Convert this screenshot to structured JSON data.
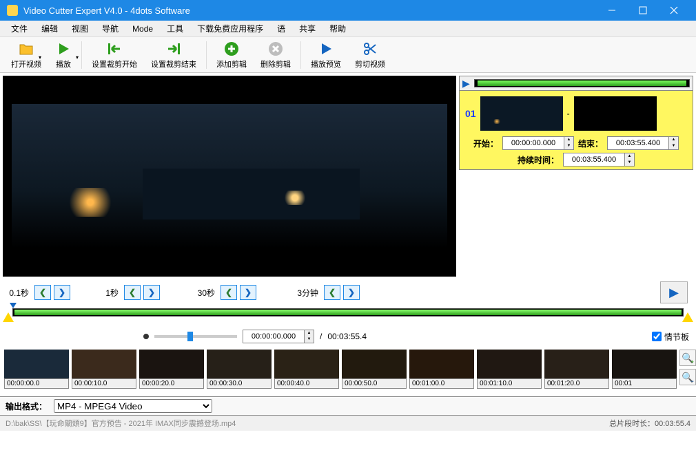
{
  "window": {
    "title": "Video Cutter Expert V4.0 - 4dots Software"
  },
  "menu": [
    "文件",
    "编辑",
    "视图",
    "导航",
    "Mode",
    "工具",
    "下载免费应用程序",
    "语",
    "共享",
    "帮助"
  ],
  "tools": [
    {
      "name": "open",
      "label": "打开视频",
      "icon": "folder",
      "color": "#fbc02d",
      "drop": true
    },
    {
      "name": "play",
      "label": "播放",
      "icon": "play",
      "color": "#2e9e1e",
      "drop": true
    },
    {
      "name": "set-start",
      "label": "设置裁剪开始",
      "icon": "arrow-left-bar",
      "color": "#2e9e1e"
    },
    {
      "name": "set-end",
      "label": "设置裁剪结束",
      "icon": "arrow-right-bar",
      "color": "#2e9e1e"
    },
    {
      "name": "add-cut",
      "label": "添加剪辑",
      "icon": "plus-circle",
      "color": "#2e9e1e"
    },
    {
      "name": "del-cut",
      "label": "删除剪辑",
      "icon": "x-circle",
      "color": "#bdbdbd"
    },
    {
      "name": "play-preview",
      "label": "播放预览",
      "icon": "play",
      "color": "#1565c0"
    },
    {
      "name": "cut-video",
      "label": "剪切视频",
      "icon": "scissors",
      "color": "#1565c0"
    }
  ],
  "clip": {
    "index": "01",
    "start_label": "开始：",
    "start": "00:00:00.000",
    "end_label": "结束：",
    "end": "00:03:55.400",
    "dur_label": "持续时间：",
    "dur": "00:03:55.400"
  },
  "seek": {
    "g1": "0.1秒",
    "g2": "1秒",
    "g3": "30秒",
    "g4": "3分钟"
  },
  "pos": {
    "current": "00:00:00.000",
    "total": "00:03:55.4",
    "storyboard_label": "情节板"
  },
  "story": [
    "00:00:00.0",
    "00:00:10.0",
    "00:00:20.0",
    "00:00:30.0",
    "00:00:40.0",
    "00:00:50.0",
    "00:01:00.0",
    "00:01:10.0",
    "00:01:20.0",
    "00:01"
  ],
  "output": {
    "label": "输出格式：",
    "value": "MP4 - MPEG4 Video"
  },
  "status": {
    "path": "D:\\bak\\SS\\【玩命關頭9】官方预告 - 2021年 IMAX同步震撼登场.mp4",
    "total_label": "总片段时长：",
    "total": "00:03:55.4"
  }
}
